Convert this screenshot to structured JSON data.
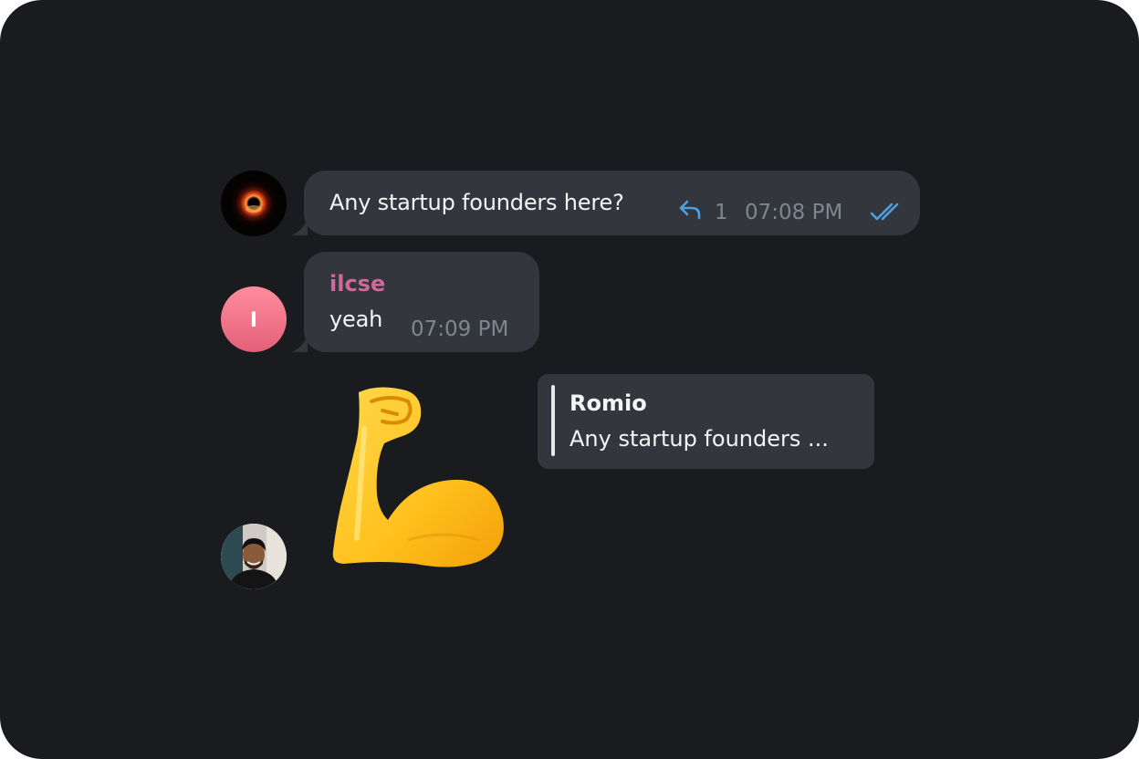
{
  "messages": [
    {
      "avatar": "black-hole-avatar",
      "text": "Any startup founders here?",
      "reply_count": "1",
      "time": "07:08 PM",
      "status_icon": "double-check-icon"
    },
    {
      "avatar_initial": "I",
      "sender": "ilcse",
      "text": "yeah",
      "time": "07:09 PM"
    },
    {
      "avatar": "person-photo-avatar",
      "sticker": "flexed-biceps-sticker",
      "reply_to": {
        "name": "Romio",
        "preview": "Any startup founders ..."
      }
    }
  ],
  "colors": {
    "background": "#1a1b1f",
    "bubble": "#33363c",
    "accent_blue": "#4ea1e0",
    "sender_pink": "#d0689a",
    "meta_gray": "#7f8690"
  }
}
